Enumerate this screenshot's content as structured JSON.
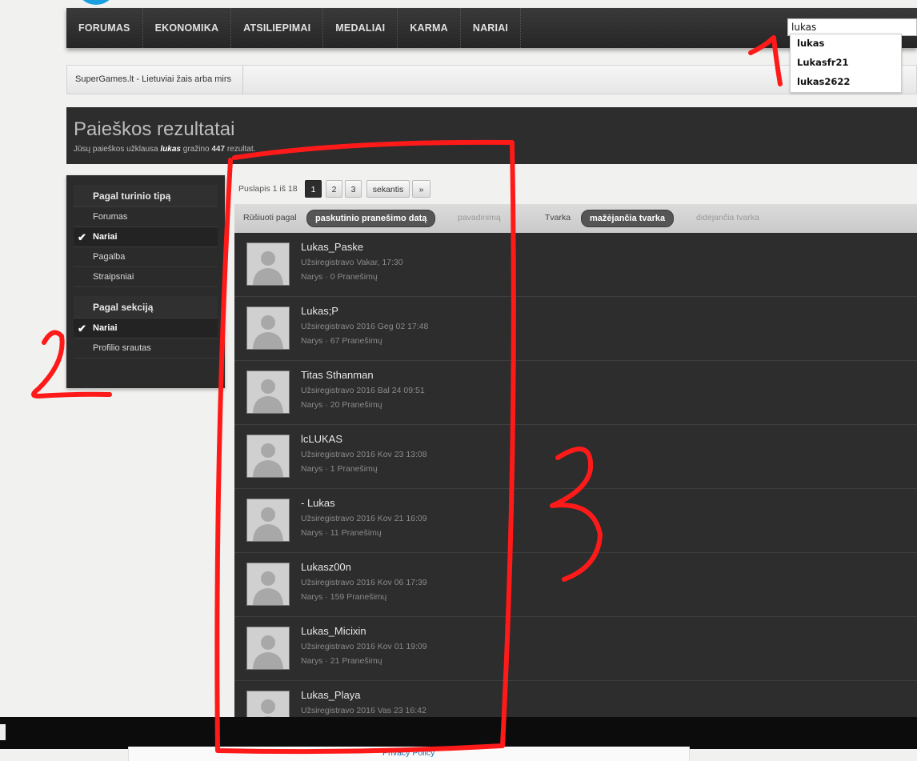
{
  "nav": {
    "items": [
      "FORUMAS",
      "EKONOMIKA",
      "ATSILIEPIMAI",
      "MEDALIAI",
      "KARMA",
      "NARIAI"
    ]
  },
  "search": {
    "value": "lukas",
    "suggestions": [
      "lukas",
      "Lukasfr21",
      "lukas2622"
    ]
  },
  "breadcrumb": {
    "item": "SuperGames.lt - Lietuviai žais arba mirs"
  },
  "header": {
    "title": "Paieškos rezultatai",
    "sub_prefix": "Jūsų paieškos užklausa",
    "query": "lukas",
    "sub_mid": "gražino",
    "count": "447",
    "sub_suffix": "rezultat."
  },
  "sidebar": {
    "section1_title": "Pagal turinio tipą",
    "section1_items": [
      {
        "label": "Forumas",
        "active": false
      },
      {
        "label": "Nariai",
        "active": true
      },
      {
        "label": "Pagalba",
        "active": false
      },
      {
        "label": "Straipsniai",
        "active": false
      }
    ],
    "section2_title": "Pagal sekciją",
    "section2_items": [
      {
        "label": "Nariai",
        "active": true
      },
      {
        "label": "Profilio srautas",
        "active": false
      }
    ]
  },
  "pagination": {
    "label": "Puslapis 1 iš 18",
    "pages": [
      "1",
      "2",
      "3"
    ],
    "current": "1",
    "next": "sekantis",
    "last": "»"
  },
  "sort": {
    "label": "Rūšiuoti pagal",
    "active": "paskutinio pranešimo datą",
    "alt": "pavadinimą",
    "order_label": "Tvarka",
    "order_active": "mažėjančia tvarka",
    "order_alt": "didėjančia tvarka"
  },
  "results": [
    {
      "name": "Lukas_Paske",
      "registered": "Užsiregistravo Vakar, 17:30",
      "meta": "Narys · 0 Pranešimų"
    },
    {
      "name": "Lukas;P",
      "registered": "Užsiregistravo 2016 Geg 02 17:48",
      "meta": "Narys · 67 Pranešimų"
    },
    {
      "name": "Titas Sthanman",
      "registered": "Užsiregistravo 2016 Bal 24 09:51",
      "meta": "Narys · 20 Pranešimų"
    },
    {
      "name": "lcLUKAS",
      "registered": "Užsiregistravo 2016 Kov 23 13:08",
      "meta": "Narys · 1 Pranešimų"
    },
    {
      "name": "- Lukas",
      "registered": "Užsiregistravo 2016 Kov 21 16:09",
      "meta": "Narys · 11 Pranešimų"
    },
    {
      "name": "Lukasz00n",
      "registered": "Užsiregistravo 2016 Kov 06 17:39",
      "meta": "Narys · 159 Pranešimų"
    },
    {
      "name": "Lukas_Micixin",
      "registered": "Užsiregistravo 2016 Kov 01 19:09",
      "meta": "Narys · 21 Pranešimų"
    },
    {
      "name": "Lukas_Playa",
      "registered": "Užsiregistravo 2016 Vas 23 16:42",
      "meta": ""
    }
  ],
  "footer": {
    "privacy": "Privacy Policy"
  },
  "annotations": [
    "1",
    "2",
    "3"
  ],
  "colors": {
    "annotation": "#ff1a1a",
    "panel": "#2d2d2d",
    "accent": "#1aa0e0"
  }
}
